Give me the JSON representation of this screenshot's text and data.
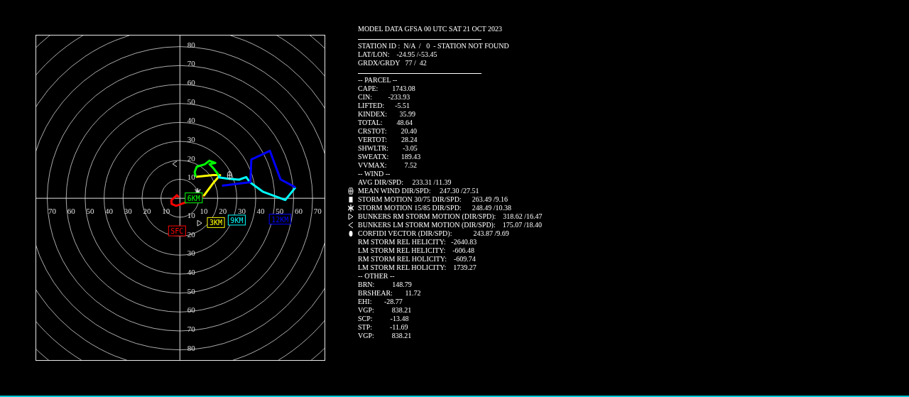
{
  "hodograph": {
    "x_labels": [
      "70",
      "60",
      "50",
      "40",
      "30",
      "20",
      "10",
      "10",
      "20",
      "30",
      "40",
      "50",
      "60",
      "70"
    ],
    "y_labels": [
      "80",
      "70",
      "60",
      "50",
      "40",
      "30",
      "20",
      "10",
      "10",
      "20",
      "30",
      "40",
      "50",
      "60",
      "70",
      "80"
    ],
    "levels": [
      {
        "text": "SFC",
        "color": "#ff0000"
      },
      {
        "text": "3KM",
        "color": "#ffff00"
      },
      {
        "text": "6KM",
        "color": "#00ff00"
      },
      {
        "text": "9KM",
        "color": "#00ffff"
      },
      {
        "text": "12KM",
        "color": "#0000ff"
      }
    ]
  },
  "report": {
    "lines": [
      {
        "kind": "text",
        "text": "MODEL DATA GFSA 00 UTC SAT 21 OCT 2023"
      },
      {
        "kind": "rule"
      },
      {
        "kind": "text",
        "text": "STATION ID :  N/A  /   0  - STATION NOT FOUND"
      },
      {
        "kind": "text",
        "text": "LAT/LON:    -24.95 /-53.45"
      },
      {
        "kind": "text",
        "text": "GRDX/GRDY   77 /  42"
      },
      {
        "kind": "rule"
      },
      {
        "kind": "text",
        "text": "-- PARCEL --"
      },
      {
        "kind": "text",
        "text": "CAPE:        1743.08"
      },
      {
        "kind": "text",
        "text": "CIN:         -233.93"
      },
      {
        "kind": "text",
        "text": "LIFTED:      -5.51"
      },
      {
        "kind": "text",
        "text": "KINDEX:       35.99"
      },
      {
        "kind": "text",
        "text": "TOTAL:        48.64"
      },
      {
        "kind": "text",
        "text": "CRSTOT:        20.40"
      },
      {
        "kind": "text",
        "text": "VERTOT:        28.24"
      },
      {
        "kind": "text",
        "text": "SHWLTR:        -3.05"
      },
      {
        "kind": "text",
        "text": "SWEATX:       189.43"
      },
      {
        "kind": "text",
        "text": "VVMAX:          7.52"
      },
      {
        "kind": "text",
        "text": "-- WIND --"
      },
      {
        "kind": "text",
        "text": "AVG DIR/SPD:     233.31 /11.39"
      },
      {
        "kind": "ellipse",
        "text": "MEAN WIND DIR/SPD:     247.30 /27.51"
      },
      {
        "kind": "square",
        "text": "STORM MOTION 30/75 DIR/SPD:      263.49 /9.16"
      },
      {
        "kind": "asterisk",
        "text": "STORM MOTION 15/85 DIR/SPD:      248.49 /10.38"
      },
      {
        "kind": "triangle",
        "text": "BUNKERS RM STORM MOTION (DIR/SPD):    318.62 /16.47"
      },
      {
        "kind": "chevron",
        "text": "BUNKERS LM STORM MOTION (DIR/SPD):    175.07 /18.40"
      },
      {
        "kind": "dot",
        "text": "CORFIDI VECTOR (DIR/SPD):            243.87 /9.69"
      },
      {
        "kind": "text",
        "text": "RM STORM REL HELICITY:   -2640.83"
      },
      {
        "kind": "text",
        "text": "LM STORM REL HELICITY:    -606.48"
      },
      {
        "kind": "text",
        "text": "RM STORM REL HOLICITY:    -609.74"
      },
      {
        "kind": "text",
        "text": "LM STORM REL HOLICITY:    1739.27"
      },
      {
        "kind": "text",
        "text": "-- OTHER --"
      },
      {
        "kind": "text",
        "text": "BRN:          148.79"
      },
      {
        "kind": "text",
        "text": "BRSHEAR:       11.72"
      },
      {
        "kind": "text",
        "text": "EHI:       -28.77"
      },
      {
        "kind": "text",
        "text": "VGP:          838.21"
      },
      {
        "kind": "text",
        "text": "SCP:          -13.48"
      },
      {
        "kind": "text",
        "text": "STP:          -11.69"
      },
      {
        "kind": "text",
        "text": "VGP:          838.21"
      }
    ]
  }
}
